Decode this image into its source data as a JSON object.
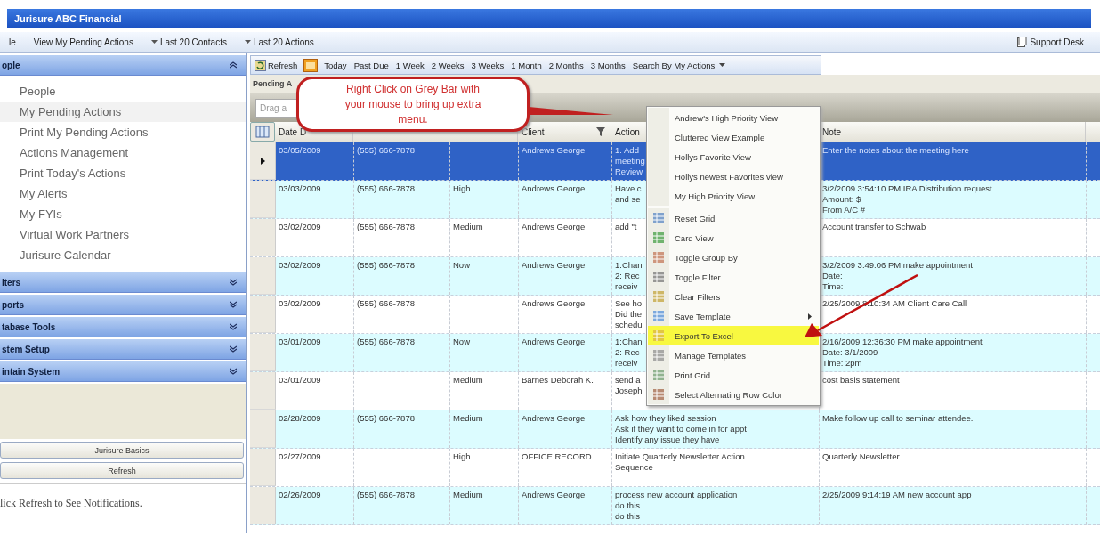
{
  "window": {
    "title": "Jurisure ABC Financial"
  },
  "menu_bar": {
    "items": [
      {
        "label": "le",
        "dropdown": false
      },
      {
        "label": "View My Pending Actions",
        "dropdown": false
      },
      {
        "label": "Last 20 Contacts",
        "dropdown": true
      },
      {
        "label": "Last 20 Actions",
        "dropdown": true
      }
    ],
    "support": "Support Desk"
  },
  "sidebar": {
    "header": "ople",
    "items": [
      {
        "label": "People",
        "selected": false
      },
      {
        "label": "My Pending Actions",
        "selected": true
      },
      {
        "label": "Print My Pending Actions",
        "selected": false
      },
      {
        "label": "Actions Management",
        "selected": false
      },
      {
        "label": "Print Today's Actions",
        "selected": false
      },
      {
        "label": "My Alerts",
        "selected": false
      },
      {
        "label": "My FYIs",
        "selected": false
      },
      {
        "label": "Virtual Work Partners",
        "selected": false
      },
      {
        "label": "Jurisure Calendar",
        "selected": false
      }
    ],
    "sections": [
      "lters",
      "ports",
      "tabase Tools",
      "stem Setup",
      "intain System"
    ],
    "buttons": [
      "Jurisure Basics",
      "Refresh"
    ],
    "notice": "lick Refresh to See Notifications."
  },
  "toolbar": {
    "refresh": "Refresh",
    "ranges": [
      "Today",
      "Past Due",
      "1 Week",
      "2 Weeks",
      "3 Weeks",
      "1 Month",
      "2 Months",
      "3 Months"
    ],
    "search": "Search By My Actions"
  },
  "grid": {
    "title": "Pending A",
    "group_bar": "Drag a",
    "columns": [
      {
        "label": "Date D",
        "filter": false
      },
      {
        "filter": false
      },
      {
        "filter": false
      },
      {
        "label": "Client",
        "filter": true
      },
      {
        "label": "Action",
        "filter": false
      },
      {
        "label": "Note",
        "filter": false
      }
    ],
    "rows": [
      {
        "selected": true,
        "date": "03/05/2009",
        "phone": "(555) 666-7878",
        "client": "Andrews George",
        "action": "1. Add\nmeeting\nReview",
        "note": "Enter the notes about the meeting here"
      },
      {
        "selected": false,
        "date": "03/03/2009",
        "phone": "(555) 666-7878",
        "priority": "High",
        "client": "Andrews George",
        "action": "Have c\nand se",
        "note": "3/2/2009 3:54:10 PM IRA Distribution request\nAmount: $\nFrom A/C #"
      },
      {
        "selected": false,
        "date": "03/02/2009",
        "phone": "(555) 666-7878",
        "priority": "Medium",
        "client": "Andrews George",
        "action": "add \"t",
        "note": "Account transfer to Schwab"
      },
      {
        "selected": false,
        "date": "03/02/2009",
        "phone": "(555) 666-7878",
        "priority": "Now",
        "client": "Andrews George",
        "action": "1:Chan\n2: Rec\nreceiv",
        "note": "3/2/2009 3:49:06 PM make appointment\nDate:\nTime:"
      },
      {
        "selected": false,
        "date": "03/02/2009",
        "phone": "(555) 666-7878",
        "client": "Andrews George",
        "action": "See ho\nDid the\nschedu",
        "note": "2/25/2009 8:10:34 AM Client Care Call"
      },
      {
        "selected": false,
        "date": "03/01/2009",
        "phone": "(555) 666-7878",
        "priority": "Now",
        "client": "Andrews George",
        "action": "1:Chan\n2: Rec\nreceiv",
        "note": "2/16/2009 12:36:30 PM make appointment\nDate: 3/1/2009\nTime: 2pm"
      },
      {
        "selected": false,
        "date": "03/01/2009",
        "priority": "Medium",
        "client": "Barnes Deborah K.",
        "action": "send a\nJoseph",
        "note": "cost basis statement"
      },
      {
        "selected": false,
        "date": "02/28/2009",
        "phone": "(555) 666-7878",
        "priority": "Medium",
        "client": "Andrews George",
        "action": "Ask how they liked session\nAsk if they want to come in for appt\nIdentify any issue they have",
        "note": "Make follow up call to seminar attendee."
      },
      {
        "selected": false,
        "date": "02/27/2009",
        "priority": "High",
        "client": "OFFICE RECORD",
        "action": "Initiate Quarterly Newsletter Action\nSequence",
        "note": "Quarterly Newsletter"
      },
      {
        "selected": false,
        "date": "02/26/2009",
        "phone": "(555) 666-7878",
        "priority": "Medium",
        "client": "Andrews George",
        "action": "process new account application\ndo this\ndo this",
        "note": "2/25/2009 9:14:19 AM new account app"
      }
    ]
  },
  "context_menu": {
    "items": [
      {
        "kind": "view",
        "label": "Andrew's High Priority View",
        "selected": false
      },
      {
        "kind": "view",
        "label": "Cluttered View Example",
        "selected": false
      },
      {
        "kind": "view",
        "label": "Hollys Favorite View",
        "selected": false
      },
      {
        "kind": "view",
        "label": "Hollys newest Favorites view",
        "selected": false
      },
      {
        "kind": "view",
        "label": "My High Priority View",
        "selected": false
      },
      {
        "kind": "command",
        "label": "Reset Grid",
        "selected": false
      },
      {
        "kind": "command",
        "label": "Card View",
        "selected": false
      },
      {
        "kind": "command",
        "label": "Toggle Group By",
        "selected": false
      },
      {
        "kind": "command",
        "label": "Toggle Filter",
        "selected": false
      },
      {
        "kind": "command",
        "label": "Clear Filters",
        "selected": false
      },
      {
        "kind": "submenu",
        "label": "Save Template",
        "selected": false
      },
      {
        "kind": "command",
        "label": "Export To Excel",
        "selected": true
      },
      {
        "kind": "command",
        "label": "Manage Templates",
        "selected": false
      },
      {
        "kind": "command",
        "label": "Print Grid",
        "selected": false
      },
      {
        "kind": "command",
        "label": "Select Alternating Row Color",
        "selected": false
      }
    ]
  },
  "callout": {
    "text": "Right Click on Grey Bar with your mouse to bring up extra menu."
  }
}
